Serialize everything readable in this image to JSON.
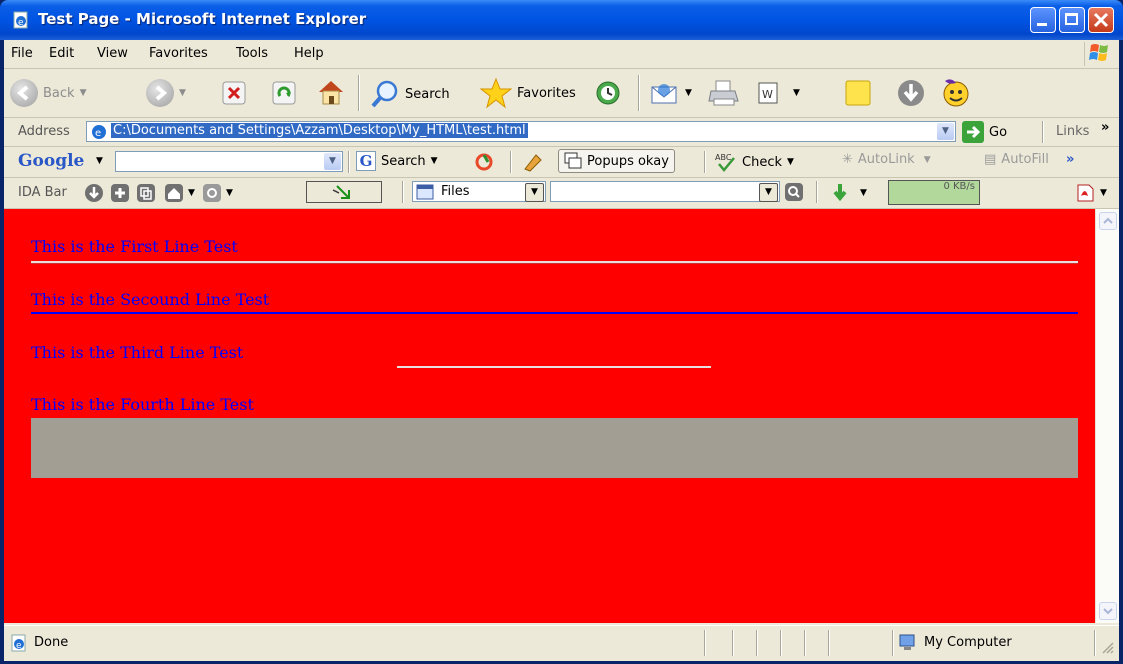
{
  "window": {
    "title": "Test Page - Microsoft Internet Explorer"
  },
  "menu": {
    "items": [
      "File",
      "Edit",
      "View",
      "Favorites",
      "Tools",
      "Help"
    ]
  },
  "toolbar": {
    "back": "Back",
    "search": "Search",
    "favorites": "Favorites"
  },
  "address": {
    "label": "Address",
    "value": "C:\\Documents and Settings\\Azzam\\Desktop\\My_HTML\\test.html",
    "go": "Go",
    "links": "Links"
  },
  "google": {
    "logo": "Google",
    "search": "Search",
    "popups": "Popups okay",
    "check": "Check",
    "autolink": "AutoLink",
    "autofill": "AutoFill"
  },
  "ida": {
    "label": "IDA Bar",
    "files": "Files",
    "speed": "0 KB/s"
  },
  "page": {
    "lines": [
      "This is the First Line Test",
      "This is the Secound Line Test",
      "This is the Third Line Test",
      "This is the Fourth Line Test"
    ],
    "background": "#ff0000",
    "text_color": "#0000ff",
    "box_color": "#a39e93"
  },
  "status": {
    "text": "Done",
    "zone": "My Computer"
  }
}
